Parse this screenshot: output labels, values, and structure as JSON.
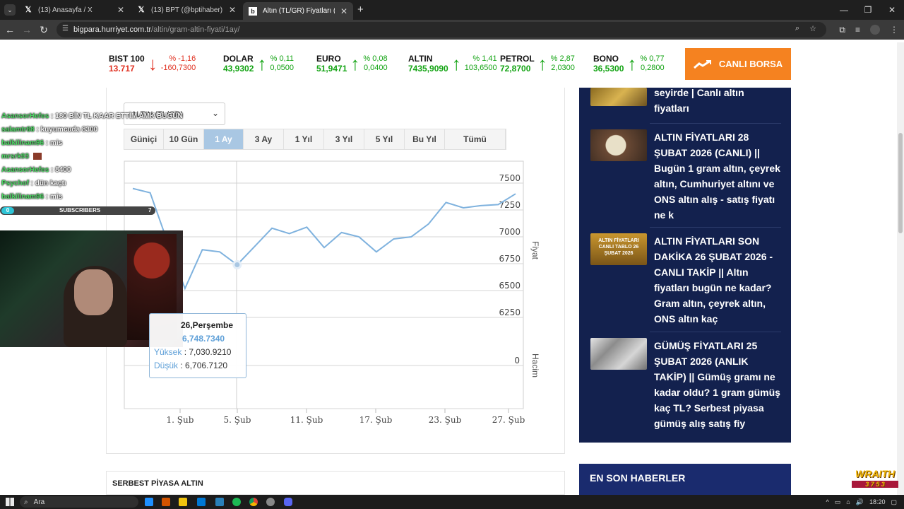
{
  "browser": {
    "tabs": [
      {
        "title": "(13) Anasayfa / X",
        "icon": "x-logo-icon"
      },
      {
        "title": "(13) BPT (@bptihaber) / X",
        "icon": "x-logo-icon"
      },
      {
        "title": "Altın (TL/GR) Fiyatları (1 Ay) - A",
        "icon": "bigpara-icon"
      }
    ],
    "url_domain": "bigpara.hurriyet.com.tr",
    "url_path": "/altin/gram-altin-fiyati/1ay/"
  },
  "ticker": [
    {
      "name": "BIST 100",
      "value": "13.717",
      "pct": "% -1,16",
      "change": "-160,7300",
      "dir": "down"
    },
    {
      "name": "DOLAR",
      "value": "43,9302",
      "pct": "% 0,11",
      "change": "0,0500",
      "dir": "up"
    },
    {
      "name": "EURO",
      "value": "51,9471",
      "pct": "% 0,08",
      "change": "0,0400",
      "dir": "up"
    },
    {
      "name": "ALTIN",
      "value": "7435,9090",
      "pct": "% 1,41",
      "change": "103,6500",
      "dir": "up"
    },
    {
      "name": "PETROL",
      "value": "72,8700",
      "pct": "% 2,87",
      "change": "2,0300",
      "dir": "up"
    },
    {
      "name": "BONO",
      "value": "36,5300",
      "pct": "% 0,77",
      "change": "0,2800",
      "dir": "up"
    }
  ],
  "canli_borsa": "CANLI BORSA",
  "instrument_select": "ALTIN (TL/GR)",
  "ranges": [
    "Güniçi",
    "10 Gün",
    "1 Ay",
    "3 Ay",
    "1 Yıl",
    "3 Yıl",
    "5 Yıl",
    "Bu Yıl",
    "Tümü"
  ],
  "active_range": "1 Ay",
  "chart_data": {
    "type": "line",
    "x_ticks": [
      "1. Şub",
      "5. Şub",
      "11. Şub",
      "17. Şub",
      "23. Şub",
      "27. Şub"
    ],
    "y_ticks": [
      "7500",
      "7250",
      "7000",
      "6750",
      "6500",
      "6250"
    ],
    "y_axis_label": "Fiyat",
    "volume_axis_label": "Hacim",
    "volume_ticks": [
      "0"
    ],
    "ylim": [
      6250,
      7500
    ],
    "series": [
      {
        "values": [
          7450,
          7410,
          6950,
          6520,
          6880,
          6860,
          6740,
          6910,
          7080,
          7030,
          7090,
          6900,
          7040,
          7000,
          6860,
          6980,
          7000,
          7120,
          7320,
          7270,
          7290,
          7300,
          7400
        ]
      }
    ],
    "grid": true,
    "tooltip": {
      "date": "26,Perşembe",
      "value": "6,748.7340",
      "high_label": "Yüksek",
      "high": "7,030.9210",
      "low_label": "Düşük",
      "low": "6,706.7120"
    }
  },
  "section_title": "SERBEST PİYASA ALTIN",
  "news": [
    {
      "title": "seyirde | Canlı altın fiyatları"
    },
    {
      "title": "ALTIN FİYATLARI 28 ŞUBAT 2026 (CANLI) || Bugün 1 gram altın, çeyrek altın, Cumhuriyet altını ve ONS altın alış - satış fiyatı ne k"
    },
    {
      "title": "ALTIN FİYATLARI SON DAKİKA 26 ŞUBAT 2026 - CANLI TAKİP || Altın fiyatları bugün ne kadar? Gram altın, çeyrek altın, ONS altın kaç",
      "thumb_text": "ALTIN FİYATLARI CANLI TABLO 26 ŞUBAT 2026"
    },
    {
      "title": "GÜMÜŞ FİYATLARI 25 ŞUBAT 2026 (ANLIK TAKİP) || Gümüş gramı ne kadar oldu? 1 gram gümüş kaç TL? Serbest piyasa gümüş alış satış fiy"
    }
  ],
  "en_son": "EN SON HABERLER",
  "stream": {
    "chat": [
      {
        "user": "AsansorHefes",
        "msg": "180 BİN TL KAAR ETTİM AMK BUGÜN"
      },
      {
        "user": "salamtr68",
        "msg": "kuyumcuda 8300"
      },
      {
        "user": "balkilinam96",
        "msg": "mis"
      },
      {
        "user": "mrsrk93",
        "msg": ""
      },
      {
        "user": "AsansorHefes",
        "msg": "8400"
      },
      {
        "user": "Psychof",
        "msg": "dün kaçtı"
      },
      {
        "user": "balkilinam96",
        "msg": "mis"
      }
    ],
    "subscribers_label": "SUBSCRIBERS",
    "subscribers_count": "0",
    "subscribers_goal": "7",
    "brand": "WRAITH",
    "brand_sub": "3 7 5 3"
  },
  "taskbar": {
    "search_placeholder": "Ara",
    "time": "18:20"
  }
}
